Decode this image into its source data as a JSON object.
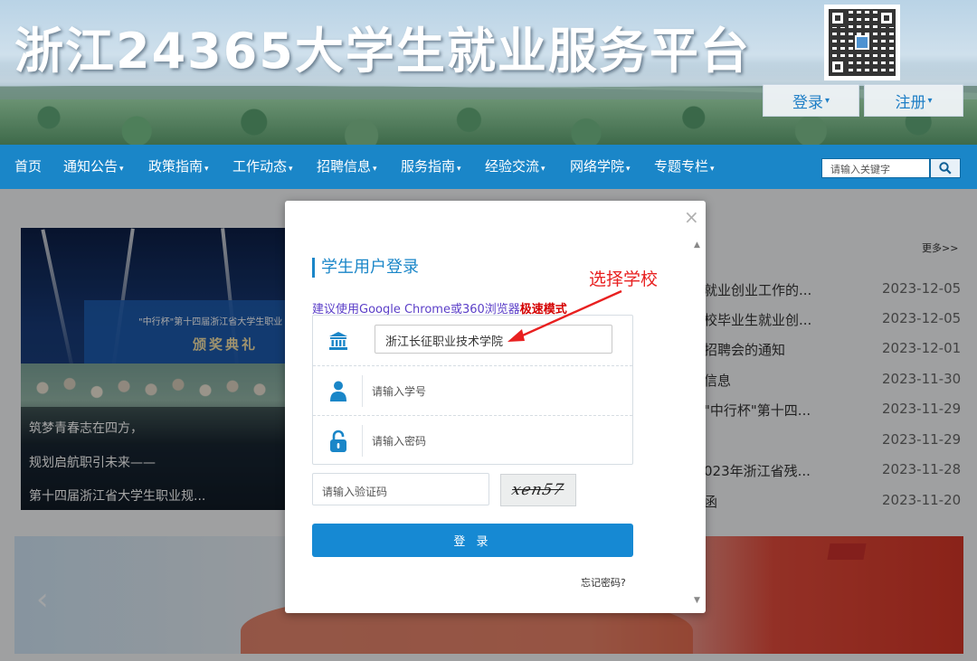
{
  "header": {
    "site_title": "浙江24365大学生就业服务平台",
    "login_button": "登录",
    "register_button": "注册"
  },
  "nav": {
    "items": [
      {
        "label": "首页",
        "has_dropdown": false
      },
      {
        "label": "通知公告",
        "has_dropdown": true
      },
      {
        "label": "政策指南",
        "has_dropdown": true
      },
      {
        "label": "工作动态",
        "has_dropdown": true
      },
      {
        "label": "招聘信息",
        "has_dropdown": true
      },
      {
        "label": "服务指南",
        "has_dropdown": true
      },
      {
        "label": "经验交流",
        "has_dropdown": true
      },
      {
        "label": "网络学院",
        "has_dropdown": true
      },
      {
        "label": "专题专栏",
        "has_dropdown": true
      }
    ],
    "search_placeholder": "请输入关键字"
  },
  "feature": {
    "stage_text": "\"中行杯\"第十四届浙江省大学生职业",
    "stage_award": "颁奖典礼",
    "captions": [
      "筑梦青春志在四方，",
      "规划启航职引未来——",
      "第十四届浙江省大学生职业规..."
    ]
  },
  "news": {
    "more_label": "更多>>",
    "items": [
      {
        "title": "就业创业工作的...",
        "date": "2023-12-05"
      },
      {
        "title": "校毕业生就业创...",
        "date": "2023-12-05"
      },
      {
        "title": "招聘会的通知",
        "date": "2023-12-01"
      },
      {
        "title": "信息",
        "date": "2023-11-30"
      },
      {
        "title": "\"中行杯\"第十四...",
        "date": "2023-11-29"
      },
      {
        "title": "",
        "date": "2023-11-29"
      },
      {
        "title": "023年浙江省残...",
        "date": "2023-11-28"
      },
      {
        "title": "函",
        "date": "2023-11-20"
      }
    ]
  },
  "modal": {
    "close_label": "×",
    "heading": "学生用户登录",
    "browser_tip_prefix": "建议使用Google Chrome或360浏览器",
    "browser_tip_emphasis": "极速模式",
    "school_value": "浙江长征职业技术学院",
    "student_id_placeholder": "请输入学号",
    "password_placeholder": "请输入密码",
    "captcha_placeholder": "请输入验证码",
    "captcha_text": "xen57",
    "login_button": "登 录",
    "forgot_password": "忘记密码?"
  },
  "annotation": {
    "label": "选择学校",
    "color": "#e82020"
  },
  "colors": {
    "nav_bg": "#1a86c8",
    "primary_button": "#1689d3",
    "heading_accent": "#1a86c8",
    "tip_text": "#5b3fc8",
    "tip_emphasis": "#d40000"
  },
  "icons": {
    "school": "bank-building-icon",
    "user": "person-icon",
    "password": "lock-icon",
    "search": "search-icon"
  }
}
